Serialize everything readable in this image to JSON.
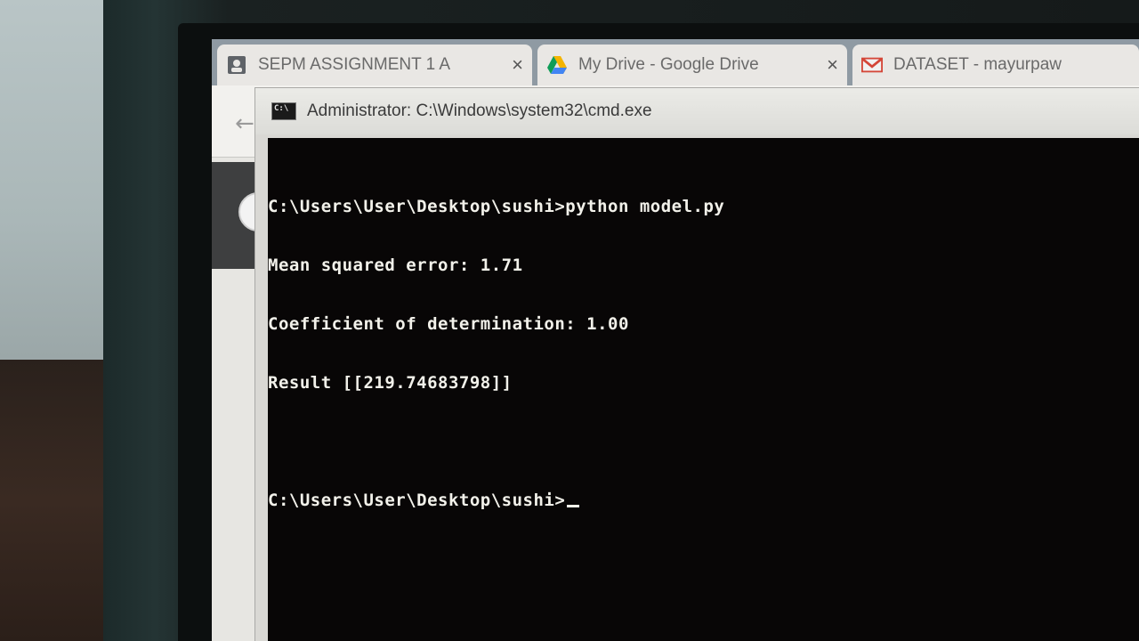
{
  "browser": {
    "tabs": [
      {
        "label": "SEPM ASSIGNMENT 1 A",
        "icon": "user-icon"
      },
      {
        "label": "My Drive - Google Drive",
        "icon": "google-drive-icon"
      },
      {
        "label": "DATASET - mayurpaw",
        "icon": "gmail-icon"
      }
    ],
    "close_glyph": "×"
  },
  "cmd": {
    "title": "Administrator: C:\\Windows\\system32\\cmd.exe",
    "lines": [
      "C:\\Users\\User\\Desktop\\sushi>python model.py",
      "Mean squared error: 1.71",
      "Coefficient of determination: 1.00",
      "Result [[219.74683798]]",
      "",
      "C:\\Users\\User\\Desktop\\sushi>"
    ]
  },
  "colors": {
    "console_bg": "#080606",
    "console_fg": "#f2f1ea"
  }
}
